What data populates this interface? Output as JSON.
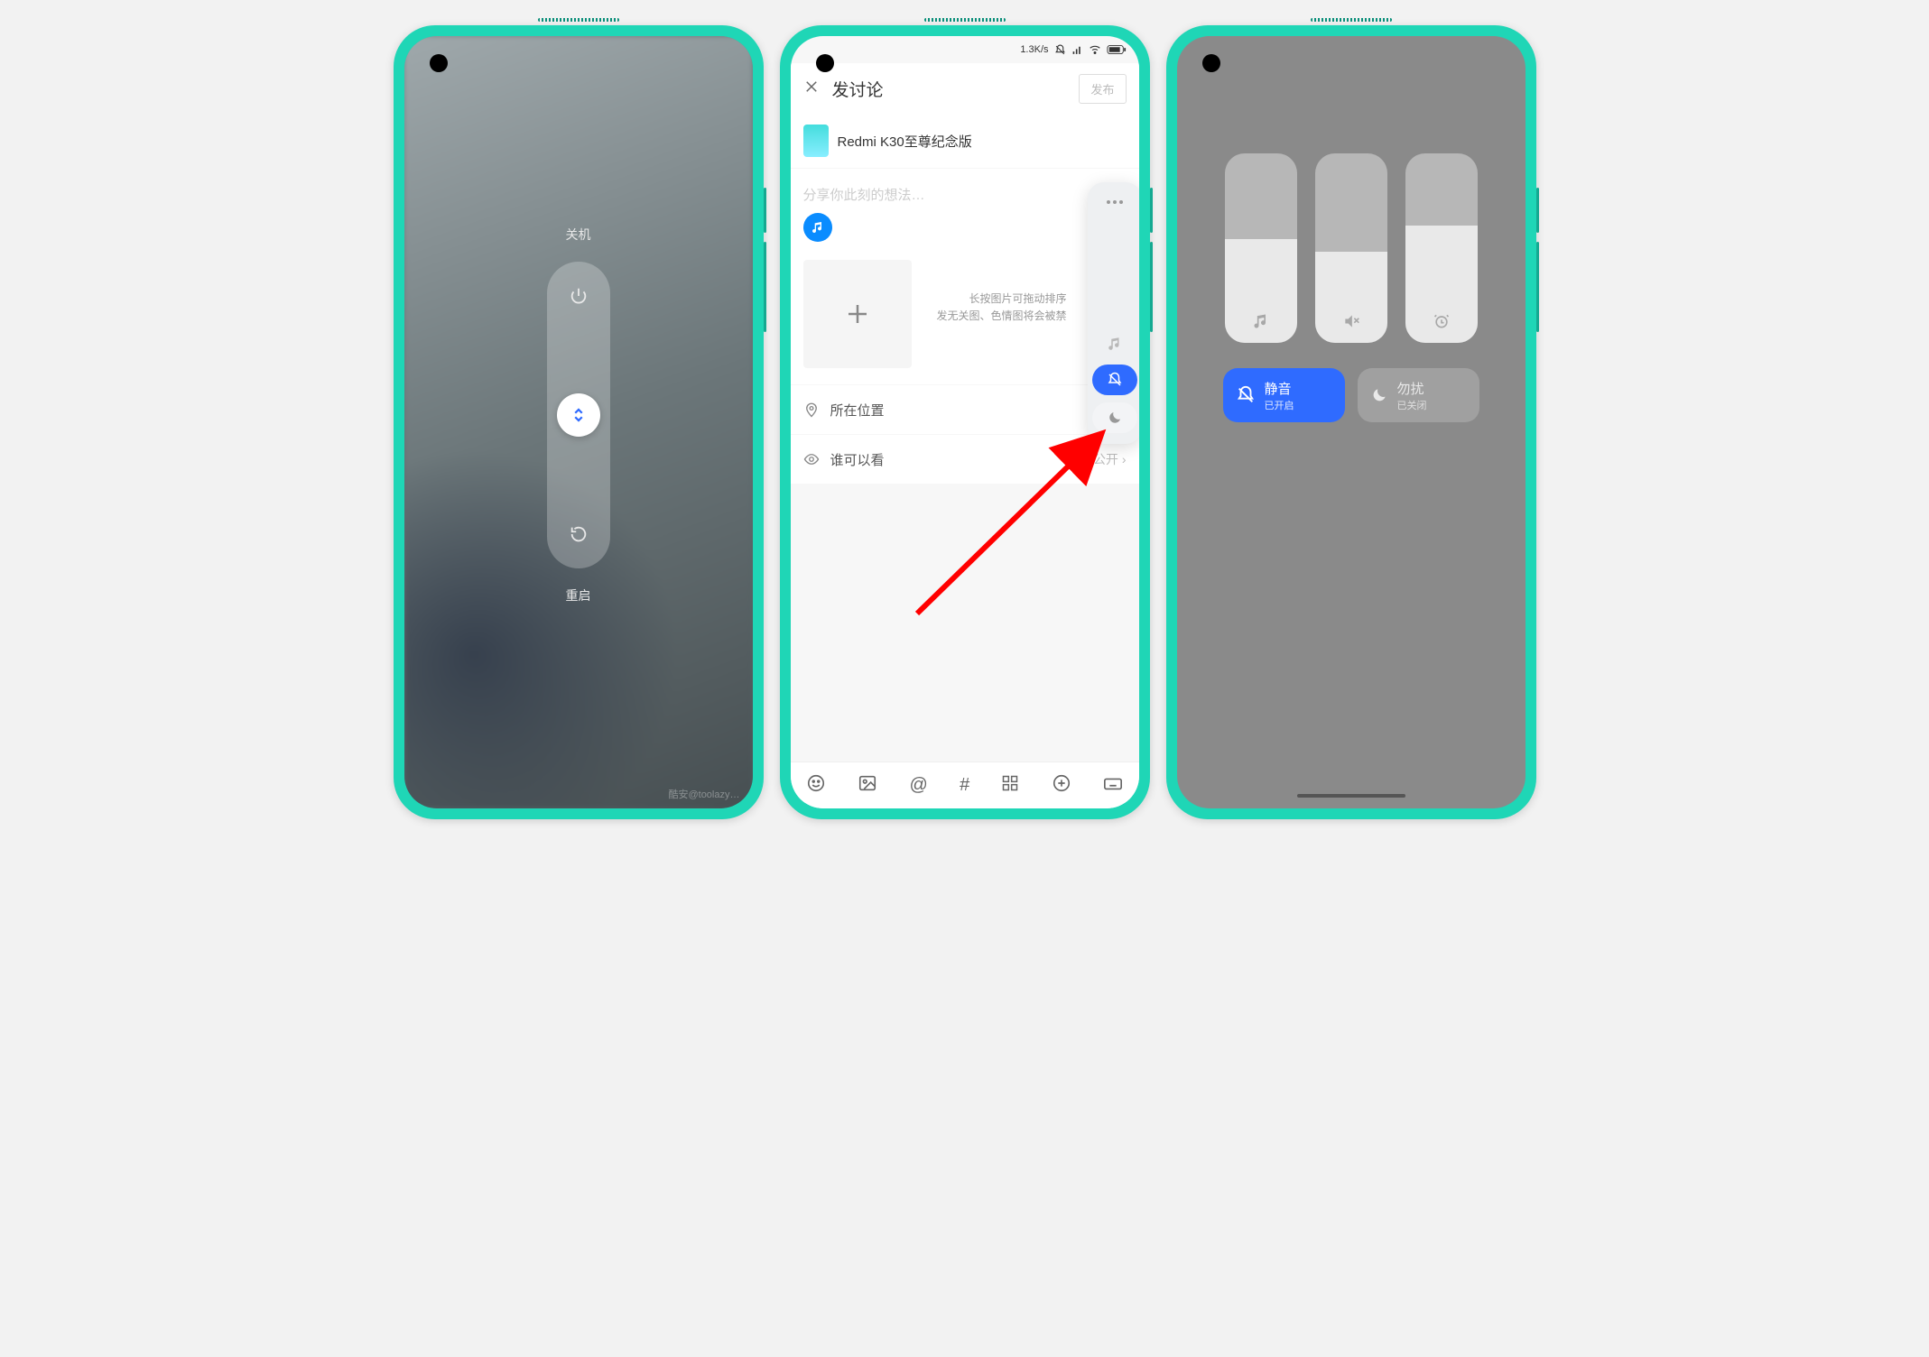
{
  "phone1": {
    "shutdown_label": "关机",
    "restart_label": "重启",
    "watermark": "酷安@toolazy…"
  },
  "phone2": {
    "status": {
      "speed": "1.3K/s"
    },
    "header": {
      "title": "发讨论",
      "publish": "发布"
    },
    "device_name": "Redmi K30至尊纪念版",
    "placeholder": "分享你此刻的想法…",
    "hint_line1": "长按图片可拖动排序",
    "hint_line2": "发无关图、色情图将会被禁",
    "location_row": "所在位置",
    "visibility_row": "谁可以看",
    "visibility_value": "公开"
  },
  "phone3": {
    "sliders": {
      "media_fill": 55,
      "ring_fill": 48,
      "alarm_fill": 62
    },
    "mute": {
      "title": "静音",
      "status": "已开启"
    },
    "dnd": {
      "title": "勿扰",
      "status": "已关闭"
    }
  },
  "colors": {
    "accent": "#2f6bff",
    "teal": "#1fd6b6"
  }
}
